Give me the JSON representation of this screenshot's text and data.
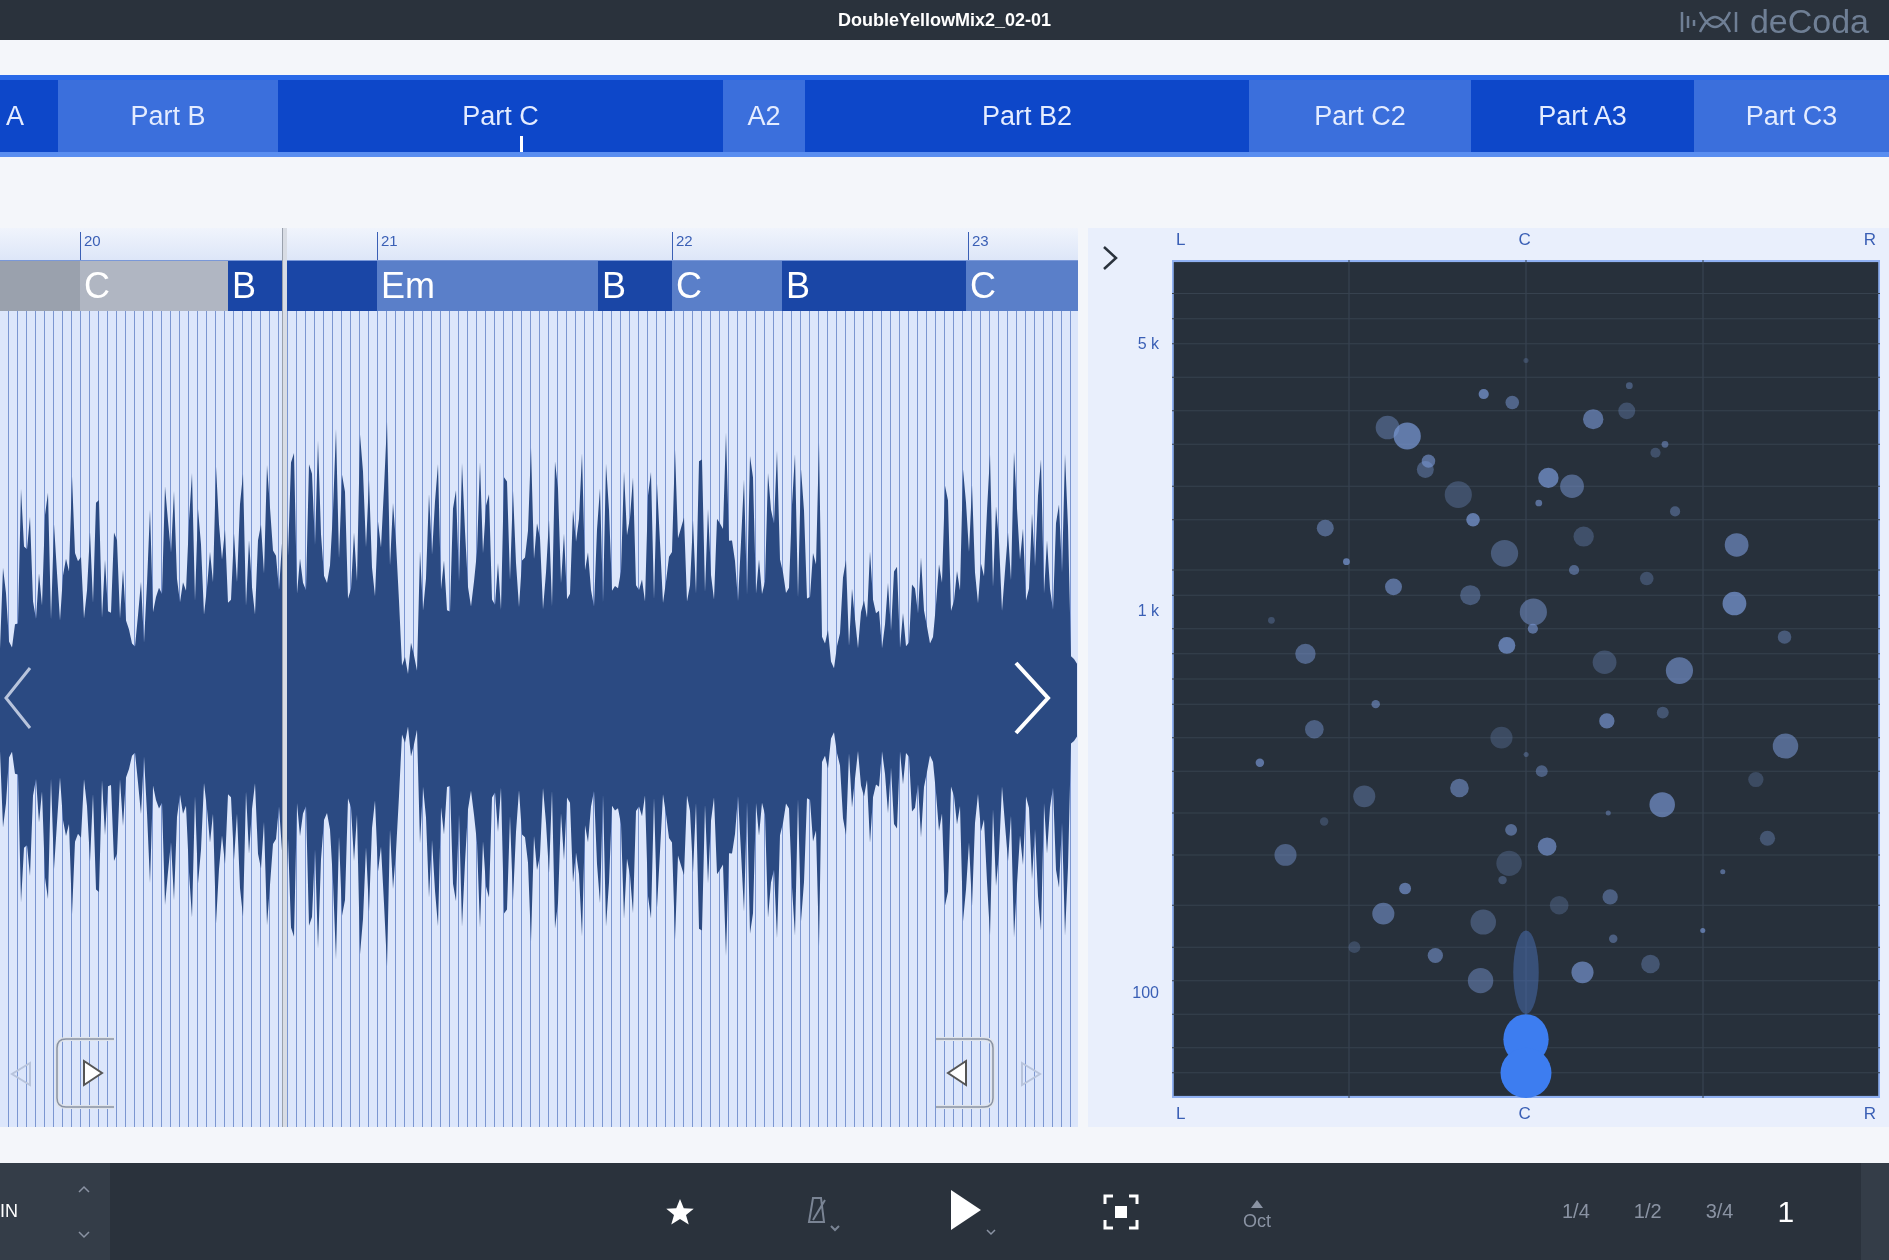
{
  "window": {
    "title": "DoubleYellowMix2_02-01",
    "logo": "deCoda"
  },
  "parts": [
    {
      "label": "A",
      "color": "#0d47c9"
    },
    {
      "label": "Part B",
      "color": "#3b6fdc"
    },
    {
      "label": "Part C",
      "color": "#0d47c9"
    },
    {
      "label": "A2",
      "color": "#3b6fdc"
    },
    {
      "label": "Part B2",
      "color": "#0d47c9"
    },
    {
      "label": "Part C2",
      "color": "#3b6fdc"
    },
    {
      "label": "Part A3",
      "color": "#0d47c9"
    },
    {
      "label": "Part C3",
      "color": "#3b6fdc"
    }
  ],
  "ruler": {
    "bars": [
      "20",
      "21",
      "22",
      "23"
    ]
  },
  "chords": [
    {
      "color": "#9aa1ad"
    },
    {
      "label": "C",
      "color": "#b0b6c2"
    },
    {
      "label": "B",
      "color": "#1a46a6"
    },
    {
      "color": "#1a46a6"
    },
    {
      "label": "Em",
      "color": "#5a7fc9"
    },
    {
      "label": "B",
      "color": "#1a46a6"
    },
    {
      "label": "C",
      "color": "#5a7fc9"
    },
    {
      "label": "B",
      "color": "#1a46a6"
    },
    {
      "label": "C",
      "color": "#5a7fc9"
    }
  ],
  "sound_field": {
    "top_labels": [
      "L",
      "C",
      "R"
    ],
    "bottom_labels": [
      "L",
      "C",
      "R"
    ],
    "y_labels": [
      "5 k",
      "1 k",
      "100"
    ]
  },
  "transport": {
    "input": "IN",
    "octave": "Oct",
    "metronome_disabled": true,
    "speeds": [
      {
        "label": "1/4",
        "selected": false
      },
      {
        "label": "1/2",
        "selected": false
      },
      {
        "label": "3/4",
        "selected": false
      },
      {
        "label": "1",
        "selected": true
      }
    ]
  }
}
